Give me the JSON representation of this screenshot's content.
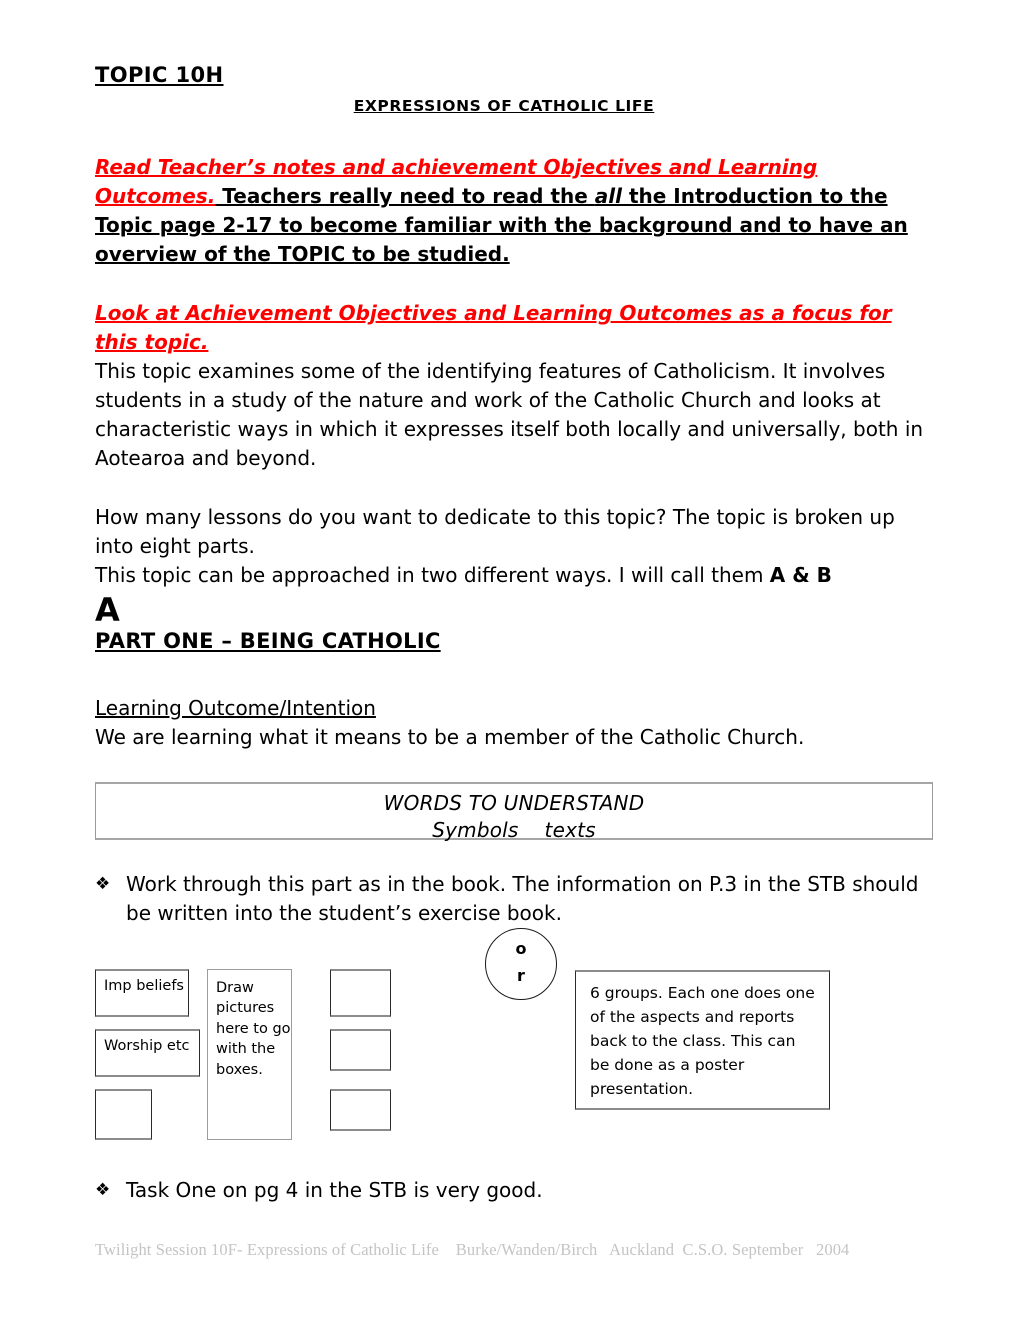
{
  "document": {
    "title": "TOPIC 10H",
    "subtitle": "EXPRESSIONS OF CATHOLIC LIFE"
  },
  "colors": {
    "accent_red": "#FF0000",
    "text_black": "#000000",
    "footer_gray": "#C4C4C4",
    "box_border": "#2B2B2B"
  },
  "intro": {
    "red_lead": "Read Teacher’s notes and achievement Objectives and Learning Outcomes.",
    "black_part_1": " Teachers really need to read the ",
    "emphasis_all": "all",
    "black_part_2": " the Introduction to the Topic page 2-17 to become familiar with the background and to have an overview of the TOPIC to be studied."
  },
  "overview": {
    "red_lead": "Look at Achievement Objectives and Learning Outcomes as a focus for this topic.",
    "body": "This topic examines some of the identifying features of Catholicism. It involves students in a study of the nature and work of the Catholic Church and looks at characteristic ways in which it expresses itself both locally and universally, both in Aotearoa and beyond."
  },
  "lessons": {
    "paragraph_1": "How many lessons do you want to dedicate to this topic? The topic is broken up into eight parts.",
    "paragraph_2_prefix": "This topic can be approached in two different ways. I will call them ",
    "paragraph_2_bold": "A & B"
  },
  "section": {
    "letter": "A",
    "part_heading": "PART ONE – BEING CATHOLIC",
    "learning_outcome_heading": "Learning Outcome/Intention",
    "learning_outcome_text": "We are learning what it means to be a member of the Catholic Church."
  },
  "words_to_understand": {
    "heading": "WORDS TO UNDERSTAND",
    "word_1": "Symbols",
    "word_2": "texts"
  },
  "bullets": [
    {
      "glyph": "❖",
      "text": "Work through this part as in the book. The information on P.3 in the STB should be written into the student’s exercise book."
    },
    {
      "glyph": "❖",
      "text": "Task One on pg 4 in the STB is very good."
    }
  ],
  "diagram": {
    "box_imp_beliefs": "Imp beliefs",
    "box_worship": "Worship etc",
    "box_draw": "Draw pictures here to go with the boxes.",
    "connector_top": "o",
    "connector_bottom": "r",
    "box_groups": "6 groups. Each one does one of the aspects and reports back to the class. This can be done as a poster presentation."
  },
  "footer": {
    "text": "Twilight Session 10F- Expressions of Catholic Life    Burke/Wanden/Birch   Auckland  C.S.O. September   2004"
  }
}
